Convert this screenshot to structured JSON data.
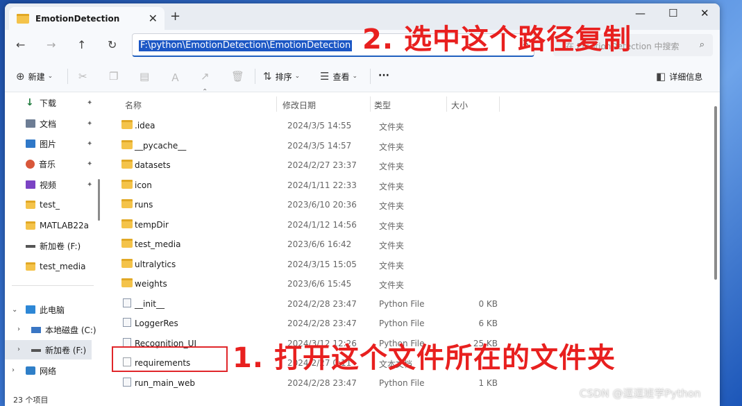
{
  "window": {
    "tab_title": "EmotionDetection",
    "close_glyph": "✕",
    "new_tab_glyph": "+",
    "minimize_glyph": "—",
    "maximize_glyph": "☐",
    "window_close_glyph": "✕"
  },
  "nav": {
    "back_glyph": "←",
    "forward_glyph": "→",
    "up_glyph": "↑",
    "refresh_glyph": "↻",
    "address": "F:\\python\\EmotionDetection\\EmotionDetection",
    "address_clear_glyph": "✕",
    "search_placeholder": "在 EmotionDetection 中搜索",
    "search_glyph": "⌕"
  },
  "toolbar": {
    "new_label": "新建",
    "sort_label": "排序",
    "view_label": "查看",
    "more_label": "···",
    "details_label": "详细信息"
  },
  "sidebar": {
    "items": [
      {
        "label": "下载",
        "icon": "download-icon",
        "pinned": true
      },
      {
        "label": "文档",
        "icon": "documents-icon",
        "pinned": true
      },
      {
        "label": "图片",
        "icon": "pictures-icon",
        "pinned": true
      },
      {
        "label": "音乐",
        "icon": "music-icon",
        "pinned": true
      },
      {
        "label": "视频",
        "icon": "videos-icon",
        "pinned": true
      },
      {
        "label": "test_",
        "icon": "folder-icon",
        "pinned": false
      },
      {
        "label": "MATLAB22a",
        "icon": "folder-icon",
        "pinned": false
      },
      {
        "label": "新加卷 (F:)",
        "icon": "drive-icon",
        "pinned": false
      },
      {
        "label": "test_media",
        "icon": "folder-icon",
        "pinned": false
      }
    ],
    "this_pc": "此电脑",
    "local_disk": "本地磁盘 (C:)",
    "new_volume": "新加卷 (F:)",
    "network": "网络",
    "pin_glyph": "📌"
  },
  "columns": {
    "name": "名称",
    "date": "修改日期",
    "type": "类型",
    "size": "大小"
  },
  "files": [
    {
      "name": ".idea",
      "date": "2024/3/5 14:55",
      "type": "文件夹",
      "size": "",
      "kind": "folder"
    },
    {
      "name": "__pycache__",
      "date": "2024/3/5 14:57",
      "type": "文件夹",
      "size": "",
      "kind": "folder"
    },
    {
      "name": "datasets",
      "date": "2024/2/27 23:37",
      "type": "文件夹",
      "size": "",
      "kind": "folder"
    },
    {
      "name": "icon",
      "date": "2024/1/11 22:33",
      "type": "文件夹",
      "size": "",
      "kind": "folder"
    },
    {
      "name": "runs",
      "date": "2023/6/10 20:36",
      "type": "文件夹",
      "size": "",
      "kind": "folder"
    },
    {
      "name": "tempDir",
      "date": "2024/1/12 14:56",
      "type": "文件夹",
      "size": "",
      "kind": "folder"
    },
    {
      "name": "test_media",
      "date": "2023/6/6 16:42",
      "type": "文件夹",
      "size": "",
      "kind": "folder"
    },
    {
      "name": "ultralytics",
      "date": "2024/3/15 15:05",
      "type": "文件夹",
      "size": "",
      "kind": "folder"
    },
    {
      "name": "weights",
      "date": "2023/6/6 15:45",
      "type": "文件夹",
      "size": "",
      "kind": "folder"
    },
    {
      "name": "__init__",
      "date": "2024/2/28 23:47",
      "type": "Python File",
      "size": "0 KB",
      "kind": "py"
    },
    {
      "name": "LoggerRes",
      "date": "2024/2/28 23:47",
      "type": "Python File",
      "size": "6 KB",
      "kind": "py"
    },
    {
      "name": "Recognition_UI",
      "date": "2024/3/12 12:26",
      "type": "Python File",
      "size": "25 KB",
      "kind": "py"
    },
    {
      "name": "requirements",
      "date": "2024/2/27 0:11",
      "type": "文本文档",
      "size": "",
      "kind": "txt"
    },
    {
      "name": "run_main_web",
      "date": "2024/2/28 23:47",
      "type": "Python File",
      "size": "1 KB",
      "kind": "py"
    }
  ],
  "status": {
    "count": "23 个项目"
  },
  "annotations": {
    "step2": "2. 选中这个路径复制",
    "step1": "1. 打开这个文件所在的文件夹"
  },
  "watermark": "CSDN @逗逗班学Python",
  "colors": {
    "accent": "#1c57c5",
    "annotation": "#e8201f",
    "folder": "#f4c34a"
  }
}
